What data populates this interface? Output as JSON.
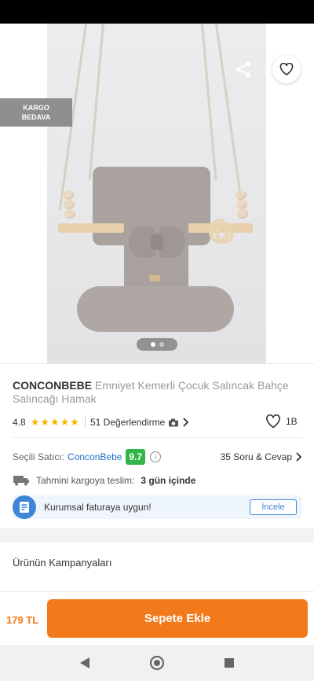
{
  "badge": {
    "line1": "KARGO",
    "line2": "BEDAVA"
  },
  "product": {
    "brand": "CONCONBEBE",
    "name": "Emniyet Kemerli Çocuk Salıncak Bahçe Salıncağı Hamak",
    "rating": "4.8",
    "reviews": "51 Değerlendirme",
    "likes": "1B"
  },
  "seller": {
    "label": "Seçili Satıcı:",
    "name": "ConconBebe",
    "score": "9.7",
    "qa": "35 Soru & Cevap"
  },
  "delivery": {
    "label": "Tahmini kargoya teslim:",
    "value": "3 gün içinde"
  },
  "invoice": {
    "text": "Kurumsal faturaya uygun!",
    "button": "İncele"
  },
  "campaign": {
    "title": "Ürünün Kampanyaları"
  },
  "cart": {
    "price": "179 TL",
    "button": "Sepete Ekle"
  },
  "icons": {
    "back": "arrow-left-icon",
    "share": "share-icon",
    "favorite": "heart-icon",
    "info": "info-icon",
    "truck": "truck-icon",
    "invoice": "invoice-icon",
    "camera": "camera-icon",
    "chevron": "chevron-right-icon"
  },
  "colors": {
    "accent": "#f27a1a",
    "link": "#1e6fc7",
    "score": "#32b54a",
    "star": "#f7b500"
  }
}
